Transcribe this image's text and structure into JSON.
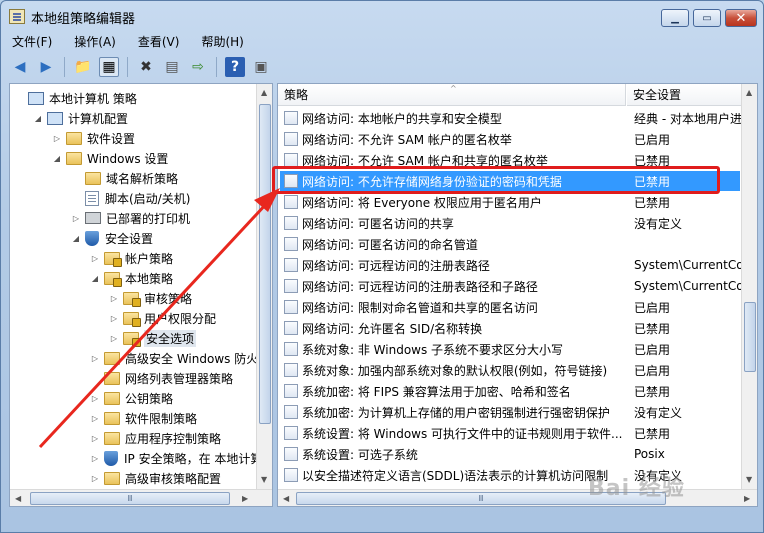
{
  "window": {
    "title": "本地组策略编辑器",
    "minimize": "▁",
    "maximize": "▭",
    "close": "✕"
  },
  "menu": [
    "文件(F)",
    "操作(A)",
    "查看(V)",
    "帮助(H)"
  ],
  "toolbar": {
    "back": "◀",
    "forward": "▶",
    "up": "📁",
    "show_tree": "▦",
    "delete": "✖",
    "properties": "▤",
    "export": "⇨",
    "help": "?",
    "view": "▣"
  },
  "tree": [
    {
      "label": "本地计算机 策略",
      "indent": 0,
      "expander": "",
      "icon": "pc"
    },
    {
      "label": "计算机配置",
      "indent": 1,
      "expander": "◢",
      "icon": "pc"
    },
    {
      "label": "软件设置",
      "indent": 2,
      "expander": "▷",
      "icon": "folder"
    },
    {
      "label": "Windows 设置",
      "indent": 2,
      "expander": "◢",
      "icon": "folder"
    },
    {
      "label": "域名解析策略",
      "indent": 3,
      "expander": "",
      "icon": "folder"
    },
    {
      "label": "脚本(启动/关机)",
      "indent": 3,
      "expander": "",
      "icon": "doc"
    },
    {
      "label": "已部署的打印机",
      "indent": 3,
      "expander": "▷",
      "icon": "printer"
    },
    {
      "label": "安全设置",
      "indent": 3,
      "expander": "◢",
      "icon": "shield"
    },
    {
      "label": "帐户策略",
      "indent": 4,
      "expander": "▷",
      "icon": "folder-lock"
    },
    {
      "label": "本地策略",
      "indent": 4,
      "expander": "◢",
      "icon": "folder-lock"
    },
    {
      "label": "审核策略",
      "indent": 5,
      "expander": "▷",
      "icon": "folder-lock"
    },
    {
      "label": "用户权限分配",
      "indent": 5,
      "expander": "▷",
      "icon": "folder-lock"
    },
    {
      "label": "安全选项",
      "indent": 5,
      "expander": "▷",
      "icon": "folder-lock"
    },
    {
      "label": "高级安全 Windows 防火墙",
      "indent": 4,
      "expander": "▷",
      "icon": "folder"
    },
    {
      "label": "网络列表管理器策略",
      "indent": 4,
      "expander": "",
      "icon": "folder"
    },
    {
      "label": "公钥策略",
      "indent": 4,
      "expander": "▷",
      "icon": "folder"
    },
    {
      "label": "软件限制策略",
      "indent": 4,
      "expander": "▷",
      "icon": "folder"
    },
    {
      "label": "应用程序控制策略",
      "indent": 4,
      "expander": "▷",
      "icon": "folder"
    },
    {
      "label": "IP 安全策略，在 本地计算机",
      "indent": 4,
      "expander": "▷",
      "icon": "shield"
    },
    {
      "label": "高级审核策略配置",
      "indent": 4,
      "expander": "▷",
      "icon": "folder"
    }
  ],
  "columns": {
    "policy": "策略",
    "setting": "安全设置"
  },
  "policies": [
    {
      "name": "网络访问: 本地帐户的共享和安全模型",
      "value": "经典 - 对本地用户进"
    },
    {
      "name": "网络访问: 不允许 SAM 帐户的匿名枚举",
      "value": "已启用"
    },
    {
      "name": "网络访问: 不允许 SAM 帐户和共享的匿名枚举",
      "value": "已禁用"
    },
    {
      "name": "网络访问: 不允许存储网络身份验证的密码和凭据",
      "value": "已禁用",
      "selected": true
    },
    {
      "name": "网络访问: 将 Everyone 权限应用于匿名用户",
      "value": "已禁用"
    },
    {
      "name": "网络访问: 可匿名访问的共享",
      "value": "没有定义"
    },
    {
      "name": "网络访问: 可匿名访问的命名管道",
      "value": ""
    },
    {
      "name": "网络访问: 可远程访问的注册表路径",
      "value": "System\\CurrentCon"
    },
    {
      "name": "网络访问: 可远程访问的注册表路径和子路径",
      "value": "System\\CurrentCon"
    },
    {
      "name": "网络访问: 限制对命名管道和共享的匿名访问",
      "value": "已启用"
    },
    {
      "name": "网络访问: 允许匿名 SID/名称转换",
      "value": "已禁用"
    },
    {
      "name": "系统对象: 非 Windows 子系统不要求区分大小写",
      "value": "已启用"
    },
    {
      "name": "系统对象: 加强内部系统对象的默认权限(例如，符号链接)",
      "value": "已启用"
    },
    {
      "name": "系统加密: 将 FIPS 兼容算法用于加密、哈希和签名",
      "value": "已禁用"
    },
    {
      "name": "系统加密: 为计算机上存储的用户密钥强制进行强密钥保护",
      "value": "没有定义"
    },
    {
      "name": "系统设置: 将 Windows 可执行文件中的证书规则用于软件...",
      "value": "已禁用"
    },
    {
      "name": "系统设置: 可选子系统",
      "value": "Posix"
    },
    {
      "name": "以安全描述符定义语言(SDDL)语法表示的计算机访问限制",
      "value": "没有定义"
    }
  ],
  "scroll": {
    "left_h": "Ⅲ",
    "right_h": "Ⅲ"
  },
  "watermark": "Bai 经验",
  "colors": {
    "selection": "#3399ff",
    "annotation": "#e01c1c"
  }
}
